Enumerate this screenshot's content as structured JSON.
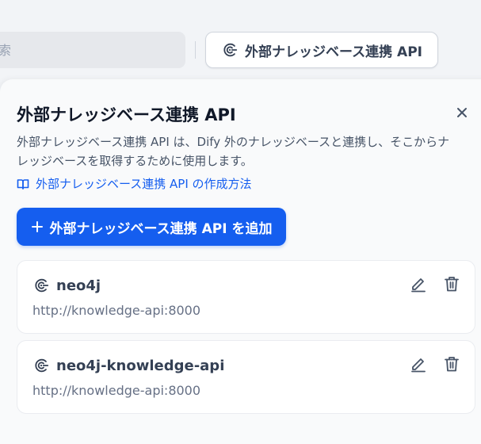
{
  "search": {
    "placeholder": "索"
  },
  "header": {
    "external_api_button_label": "外部ナレッジベース連携 API"
  },
  "panel": {
    "title": "外部ナレッジベース連携 API",
    "description": "外部ナレッジベース連携 API は、Dify 外のナレッジベースと連携し、そこからナレッジベースを取得するために使用します。",
    "howto_link": "外部ナレッジベース連携 API の作成方法",
    "add_button": "外部ナレッジベース連携 API を追加",
    "apis": [
      {
        "name": "neo4j",
        "url": "http://knowledge-api:8000"
      },
      {
        "name": "neo4j-knowledge-api",
        "url": "http://knowledge-api:8000"
      }
    ]
  },
  "colors": {
    "primary": "#155eef",
    "panel_bg": "#f9fafb",
    "page_bg": "#f2f4f7"
  },
  "icons": {
    "api": "api-connection-icon",
    "book": "book-open-icon",
    "plus": "plus-icon",
    "close": "close-icon",
    "edit": "edit-icon",
    "delete": "trash-icon"
  }
}
